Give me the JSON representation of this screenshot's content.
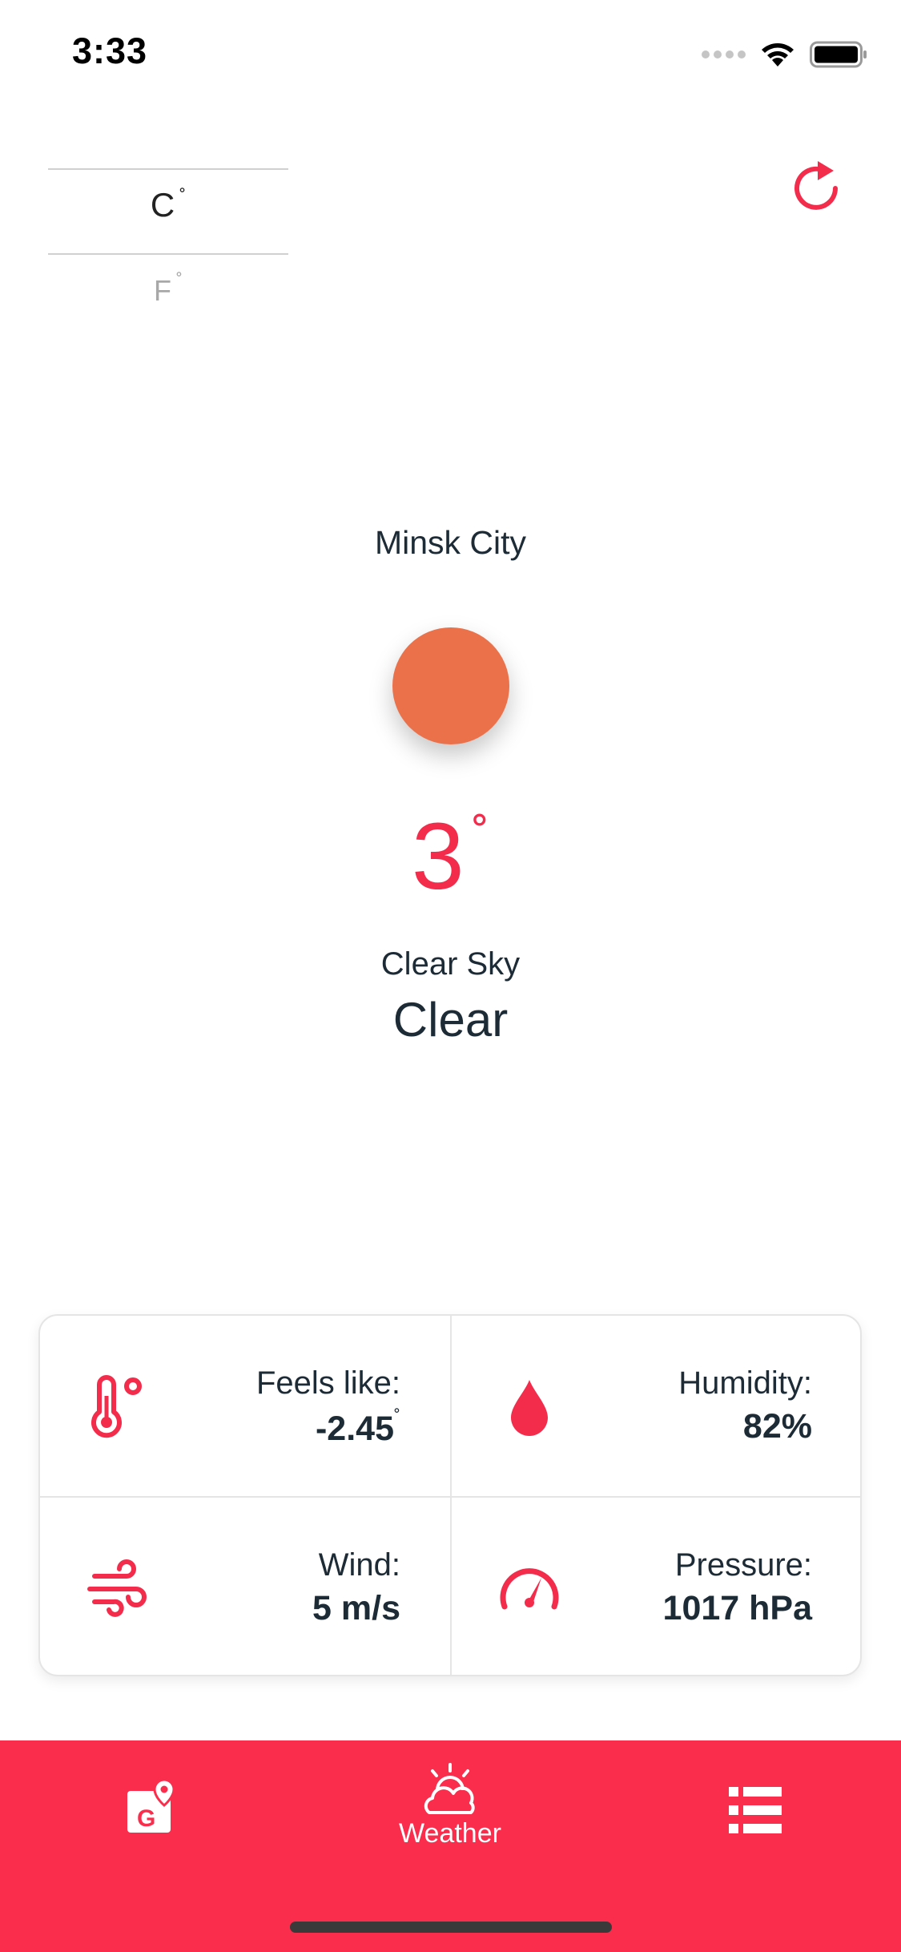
{
  "status_bar": {
    "time": "3:33"
  },
  "units": {
    "celsius": "C",
    "fahrenheit": "F",
    "degree_symbol": "˚"
  },
  "weather": {
    "city": "Minsk City",
    "temperature": "3",
    "temperature_unit": "˚",
    "description": "Clear Sky",
    "main": "Clear",
    "icon": "sun-icon"
  },
  "details": {
    "feels_like": {
      "label": "Feels like:",
      "value": "-2.45",
      "unit": "˚",
      "icon": "thermometer-icon"
    },
    "humidity": {
      "label": "Humidity:",
      "value": "82%",
      "icon": "water-drop-icon"
    },
    "wind": {
      "label": "Wind:",
      "value": "5 m/s",
      "icon": "wind-icon"
    },
    "pressure": {
      "label": "Pressure:",
      "value": "1017 hPa",
      "icon": "gauge-icon"
    }
  },
  "tab_bar": {
    "items": [
      {
        "label": "",
        "icon": "map-location-icon"
      },
      {
        "label": "Weather",
        "icon": "weather-icon"
      },
      {
        "label": "",
        "icon": "list-icon"
      }
    ]
  },
  "colors": {
    "accent": "#fa2d4c",
    "temperature": "#f42c4c",
    "sun": "#eb714b",
    "text_dark": "#1c2b36"
  }
}
